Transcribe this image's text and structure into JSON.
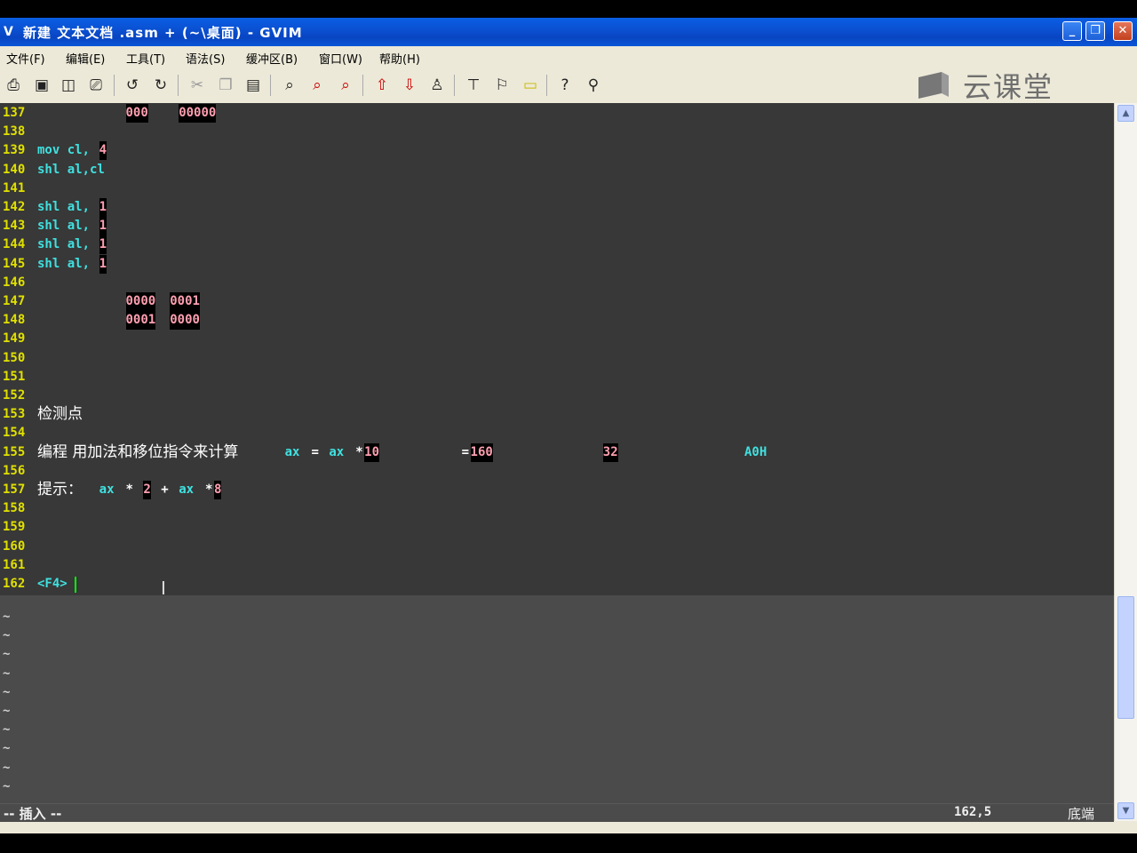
{
  "window": {
    "title": "新建 文本文档 .asm + (~\\桌面) - GVIM",
    "app_icon": "gvim-icon",
    "controls": {
      "minimize": "_",
      "maximize": "❐",
      "close": "✕"
    }
  },
  "menu": [
    "文件(F)",
    "编辑(E)",
    "工具(T)",
    "语法(S)",
    "缓冲区(B)",
    "窗口(W)",
    "帮助(H)"
  ],
  "toolbar_icons": [
    "open-icon",
    "save-icon",
    "save-all-icon",
    "print-icon",
    "undo-icon",
    "redo-icon",
    "cut-icon",
    "copy-icon",
    "paste-icon",
    "find-replace-icon",
    "find-next-icon",
    "find-prev-icon",
    "load-session-icon",
    "save-session-icon",
    "run-script-icon",
    "make-icon",
    "run-ctags-icon",
    "jump-tag-icon",
    "help-icon",
    "find-help-icon"
  ],
  "watermark": {
    "text": "云课堂"
  },
  "lines": [
    {
      "n": "137",
      "parts": [
        {
          "t": "000",
          "c": "num",
          "col": 10
        },
        {
          "t": "00000",
          "c": "num",
          "col": 16
        }
      ]
    },
    {
      "n": "138",
      "parts": []
    },
    {
      "n": "139",
      "parts": [
        {
          "t": "mov cl,",
          "c": "kw",
          "col": 0
        },
        {
          "t": "4",
          "c": "num",
          "col": 7
        }
      ]
    },
    {
      "n": "140",
      "parts": [
        {
          "t": "shl al,cl",
          "c": "kw",
          "col": 0
        }
      ]
    },
    {
      "n": "141",
      "parts": []
    },
    {
      "n": "142",
      "parts": [
        {
          "t": "shl al,",
          "c": "kw",
          "col": 0
        },
        {
          "t": "1",
          "c": "num",
          "col": 7
        }
      ]
    },
    {
      "n": "143",
      "parts": [
        {
          "t": "shl al,",
          "c": "kw",
          "col": 0
        },
        {
          "t": "1",
          "c": "num",
          "col": 7
        }
      ]
    },
    {
      "n": "144",
      "parts": [
        {
          "t": "shl al,",
          "c": "kw",
          "col": 0
        },
        {
          "t": "1",
          "c": "num",
          "col": 7
        }
      ]
    },
    {
      "n": "145",
      "parts": [
        {
          "t": "shl al,",
          "c": "kw",
          "col": 0
        },
        {
          "t": "1",
          "c": "num",
          "col": 7
        }
      ]
    },
    {
      "n": "146",
      "parts": []
    },
    {
      "n": "147",
      "parts": [
        {
          "t": "0000",
          "c": "num",
          "col": 10
        },
        {
          "t": "0001",
          "c": "num",
          "col": 15
        }
      ]
    },
    {
      "n": "148",
      "parts": [
        {
          "t": "0001",
          "c": "num",
          "col": 10
        },
        {
          "t": "0000",
          "c": "num",
          "col": 15
        }
      ]
    },
    {
      "n": "149",
      "parts": []
    },
    {
      "n": "150",
      "parts": []
    },
    {
      "n": "151",
      "parts": []
    },
    {
      "n": "152",
      "parts": []
    },
    {
      "n": "153",
      "parts": [
        {
          "t": "检测点",
          "c": "zh",
          "col": 0
        }
      ]
    },
    {
      "n": "154",
      "parts": []
    },
    {
      "n": "155",
      "parts": [
        {
          "t": "编程 用加法和移位指令来计算",
          "c": "zh",
          "col": 0
        },
        {
          "t": "ax",
          "c": "kw",
          "col": 28
        },
        {
          "t": "=",
          "c": "wh",
          "col": 31
        },
        {
          "t": "ax",
          "c": "kw",
          "col": 33
        },
        {
          "t": "*",
          "c": "wh",
          "col": 36
        },
        {
          "t": "10",
          "c": "num",
          "col": 37
        },
        {
          "t": "=",
          "c": "wh",
          "col": 48
        },
        {
          "t": "160",
          "c": "num",
          "col": 49
        },
        {
          "t": "32",
          "c": "num",
          "col": 64
        },
        {
          "t": "A0H",
          "c": "kw",
          "col": 80
        }
      ]
    },
    {
      "n": "156",
      "parts": []
    },
    {
      "n": "157",
      "parts": [
        {
          "t": "提示：",
          "c": "zh",
          "col": 0
        },
        {
          "t": "ax",
          "c": "kw",
          "col": 7
        },
        {
          "t": "*",
          "c": "wh",
          "col": 10
        },
        {
          "t": "2",
          "c": "num",
          "col": 12
        },
        {
          "t": "+",
          "c": "wh",
          "col": 14
        },
        {
          "t": "ax",
          "c": "kw",
          "col": 16
        },
        {
          "t": "*",
          "c": "wh",
          "col": 19
        },
        {
          "t": "8",
          "c": "num",
          "col": 20
        }
      ]
    },
    {
      "n": "158",
      "parts": []
    },
    {
      "n": "159",
      "parts": []
    },
    {
      "n": "160",
      "parts": []
    },
    {
      "n": "161",
      "parts": []
    },
    {
      "n": "162",
      "parts": [
        {
          "t": "<F4>",
          "c": "kw",
          "col": 0
        }
      ]
    }
  ],
  "tilde_rows": 11,
  "status": {
    "mode": "-- 插入 --",
    "position": "162,5",
    "scroll": "底端"
  }
}
